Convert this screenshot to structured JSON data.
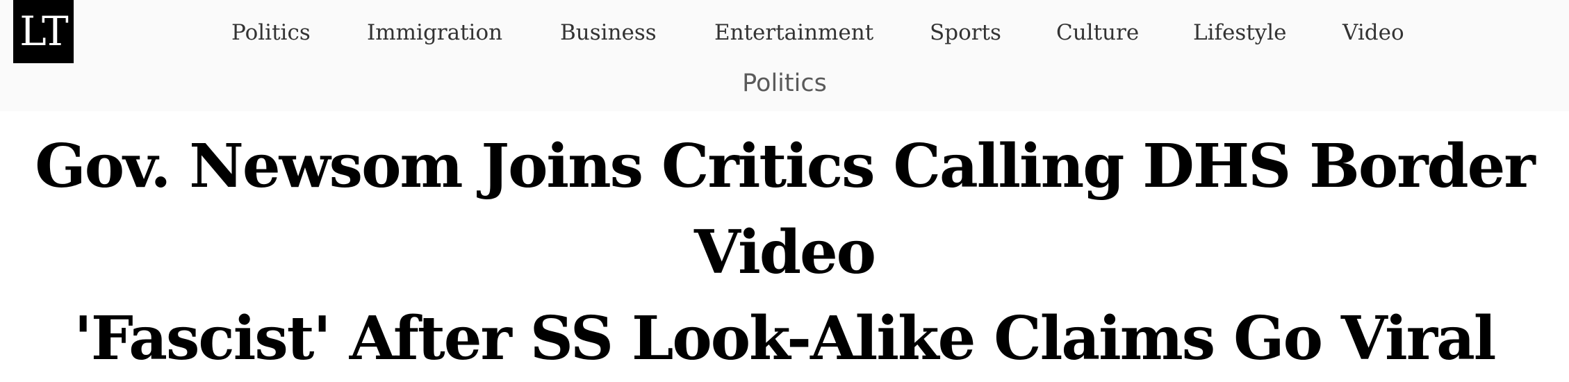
{
  "header": {
    "logo_text": "LT",
    "nav": [
      {
        "label": "Politics"
      },
      {
        "label": "Immigration"
      },
      {
        "label": "Business"
      },
      {
        "label": "Entertainment"
      },
      {
        "label": "Sports"
      },
      {
        "label": "Culture"
      },
      {
        "label": "Lifestyle"
      },
      {
        "label": "Video"
      }
    ]
  },
  "article": {
    "section": "Politics",
    "headline_line1": "Gov. Newsom Joins Critics Calling DHS Border Video",
    "headline_line2": "'Fascist' After SS Look-Alike Claims Go Viral"
  },
  "colors": {
    "header_bg": "#fafafa",
    "logo_bg": "#000000",
    "nav_text": "#333333",
    "section_text": "#5a5a5a",
    "headline_text": "#000000"
  }
}
